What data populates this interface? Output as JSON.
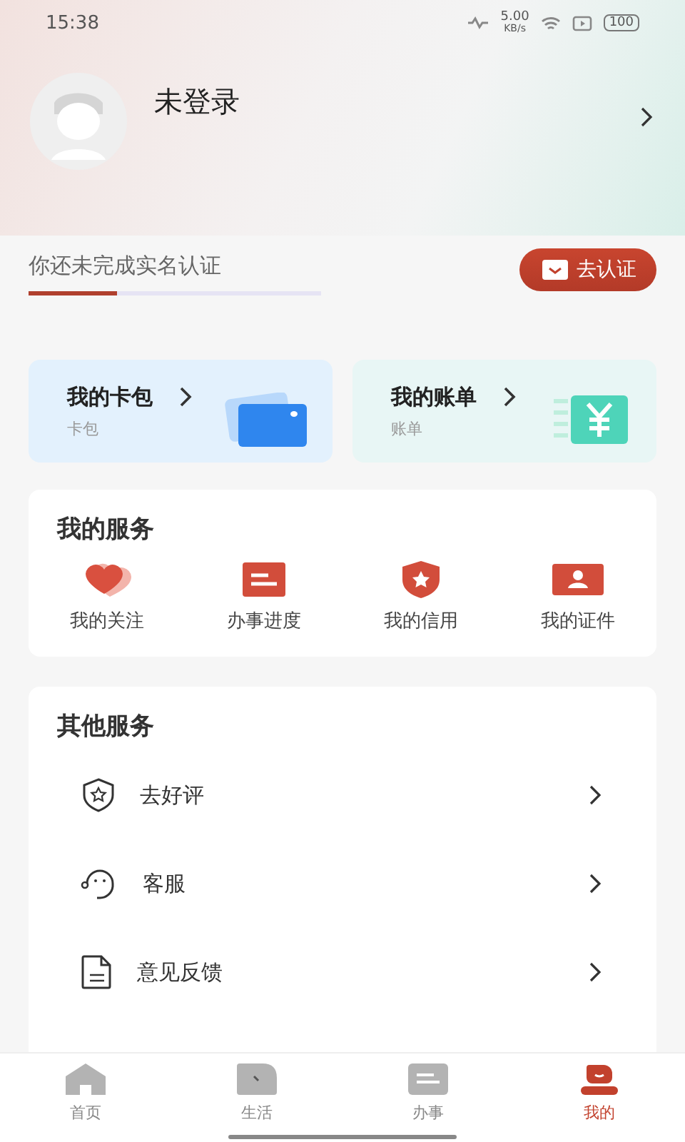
{
  "status_bar": {
    "time": "15:38",
    "speed": "5.00",
    "speed_unit": "KB/s",
    "battery": "100"
  },
  "profile": {
    "name": "未登录"
  },
  "verification": {
    "message": "你还未完成实名认证",
    "level": 0.3,
    "button": "去认证"
  },
  "cards": [
    {
      "kind": "wallet",
      "title": "我的卡包",
      "subtitle": "卡包"
    },
    {
      "kind": "bill",
      "title": "我的账单",
      "subtitle": "账单"
    }
  ],
  "my_services": {
    "title": "我的服务",
    "items": [
      {
        "kind": "heart",
        "label": "我的关注"
      },
      {
        "kind": "calendar",
        "label": "办事进度"
      },
      {
        "kind": "shield",
        "label": "我的信用"
      },
      {
        "kind": "id",
        "label": "我的证件"
      }
    ]
  },
  "other_services": {
    "title": "其他服务",
    "items": [
      {
        "kind": "review",
        "label": "去好评"
      },
      {
        "kind": "support",
        "label": "客服"
      },
      {
        "kind": "feedback",
        "label": "意见反馈"
      }
    ]
  },
  "tabs": [
    {
      "kind": "home",
      "label": "首页",
      "selected": false
    },
    {
      "kind": "life",
      "label": "生活",
      "selected": false
    },
    {
      "kind": "affairs",
      "label": "办事",
      "selected": false
    },
    {
      "kind": "mine",
      "label": "我的",
      "selected": true
    }
  ]
}
